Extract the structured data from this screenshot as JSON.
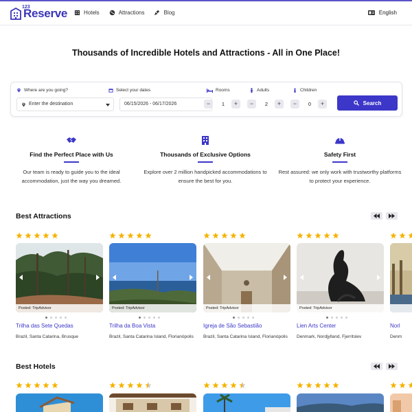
{
  "header": {
    "logo_num": "123",
    "logo_text": "Reserve",
    "nav": [
      {
        "label": "Hotels",
        "icon": "building-icon"
      },
      {
        "label": "Attractions",
        "icon": "globe-icon"
      },
      {
        "label": "Blog",
        "icon": "blog-icon"
      }
    ],
    "language": "English"
  },
  "hero": {
    "title": "Thousands of Incredible Hotels and Attractions - All in One Place!"
  },
  "search": {
    "destination_label": "Where are you going?",
    "destination_placeholder": "Enter the destination",
    "dates_label": "Select your dates",
    "dates_value": "06/15/2026 - 06/17/2026",
    "rooms_label": "Rooms",
    "rooms_value": "1",
    "adults_label": "Adults",
    "adults_value": "2",
    "children_label": "Children",
    "children_value": "0",
    "minus": "−",
    "plus": "+",
    "button_label": "Search"
  },
  "features": [
    {
      "title": "Find the Perfect Place with Us",
      "text": "Our team is ready to guide you to the ideal accommodation, just the way you dreamed.",
      "icon": "handshake-icon"
    },
    {
      "title": "Thousands of Exclusive Options",
      "text": "Explore over 2 million handpicked accommodations to ensure the best for you.",
      "icon": "hotel-icon"
    },
    {
      "title": "Safety First",
      "text": "Rest assured: we only work with trustworthy platforms to protect your experience.",
      "icon": "helmet-icon"
    }
  ],
  "attractions": {
    "title": "Best Attractions",
    "posted_label": "Posted: TripAdvisor",
    "items": [
      {
        "name": "Trilha das Sete Quedas",
        "location": "Brazil, Santa Catarina, Brusque",
        "rating": 5
      },
      {
        "name": "Trilha da Boa Vista",
        "location": "Brazil, Santa Catarina Island, Florianópolis",
        "rating": 5
      },
      {
        "name": "Igreja de São Sebastião",
        "location": "Brazil, Santa Catarina Island, Florianópolis",
        "rating": 5
      },
      {
        "name": "Lien Arts Center",
        "location": "Denmark, Nordjylland, Fjerritslev",
        "rating": 5
      },
      {
        "name": "Norl",
        "location": "Denm",
        "rating": 5
      }
    ]
  },
  "hotels": {
    "title": "Best Hotels",
    "items": [
      {
        "rating": 5
      },
      {
        "rating": 4.5
      },
      {
        "rating": 4.5
      },
      {
        "rating": 5
      },
      {
        "rating": 5
      }
    ]
  },
  "colors": {
    "accent": "#3c37c8",
    "star": "#f5b301",
    "star_empty": "#c9c9cf"
  }
}
